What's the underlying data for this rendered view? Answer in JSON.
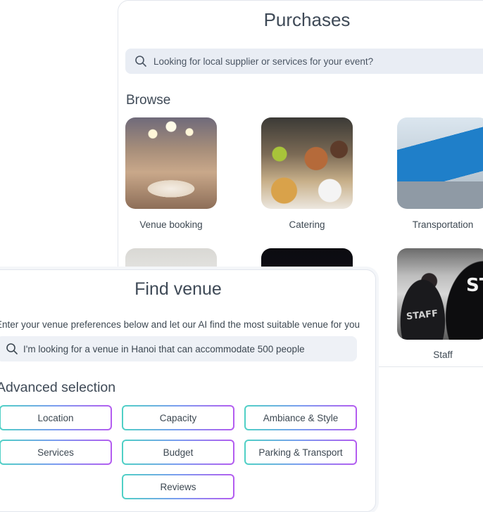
{
  "purchases": {
    "title": "Purchases",
    "search_placeholder": "Looking for local supplier or services for your event?",
    "browse_heading": "Browse",
    "tiles": [
      {
        "label": "Venue booking"
      },
      {
        "label": "Catering"
      },
      {
        "label": "Transportation"
      },
      {
        "label": ""
      },
      {
        "label": ""
      },
      {
        "label": "Staff"
      }
    ]
  },
  "find_venue": {
    "title": "Find venue",
    "description": "Enter your venue preferences below and let our AI find the most suitable venue for you",
    "search_text": "I'm looking for a venue in Hanoi that can accommodate 500 people",
    "advanced_heading": "Advanced selection",
    "chips": [
      "Location",
      "Capacity",
      "Ambiance & Style",
      "Services",
      "Budget",
      "Parking & Transport",
      "Reviews"
    ]
  },
  "colors": {
    "chip_gradient_start": "#4fd1c5",
    "chip_gradient_end": "#b45cf0",
    "search_bg": "#e9edf4",
    "heading_text": "#3f4a57"
  },
  "icons": [
    "search-icon"
  ]
}
